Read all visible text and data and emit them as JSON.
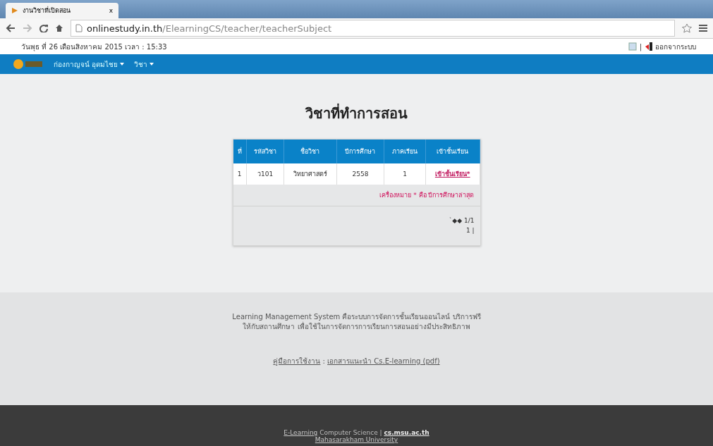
{
  "browser": {
    "tab_title": "งานวิชาที่เปิดสอน",
    "tab_close": "x",
    "url_host": "onlinestudy.in.th",
    "url_path": "/ElearningCS/teacher/teacherSubject"
  },
  "top_bar": {
    "date": "วันพุธ ที่ 26 เดือนสิงหาคม 2015   เวลา : 15:33",
    "separator": "|",
    "logout": "ออกจากระบบ"
  },
  "navbar": {
    "items": [
      {
        "label": "ก่องกาญจน์ อุดมไชย",
        "dropdown": true
      },
      {
        "label": "วิชา",
        "dropdown": true
      }
    ]
  },
  "page_title": "วิชาที่ทำการสอน",
  "table": {
    "columns": [
      "ที่",
      "รหัสวิชา",
      "ชื่อวิชา",
      "ปีการศึกษา",
      "ภาคเรียน",
      "เข้าชั้นเรียน"
    ],
    "rows": [
      {
        "cells": [
          "1",
          "ว101",
          "วิทยาศาสตร์",
          "2558",
          "1"
        ],
        "link": "เข้าชั้นเรียน*"
      }
    ],
    "note": "เครื่องหมาย * คือ ปีการศึกษาล่าสุด",
    "pager": "`◆◆ 1/1",
    "pager_2": "1 |"
  },
  "footer": {
    "lines": [
      "Learning Management System คือระบบการจัดการชั้นเรียนออนไลน์ บริการฟรี",
      "ให้กับสถานศึกษา เพื่อใช้ในการจัดการการเรียนการสอนอย่างมีประสิทธิภาพ"
    ],
    "manual_label": "คู่มือการใช้งาน",
    "manual_sep": " : ",
    "manual_link": "เอกสารแนะนำ Cs.E-learning (pdf)"
  },
  "bottom": {
    "brand": "E-Learning",
    "text": " Computer Science | ",
    "site": "cs.msu.ac.th",
    "university": "Mahasarakham University"
  }
}
